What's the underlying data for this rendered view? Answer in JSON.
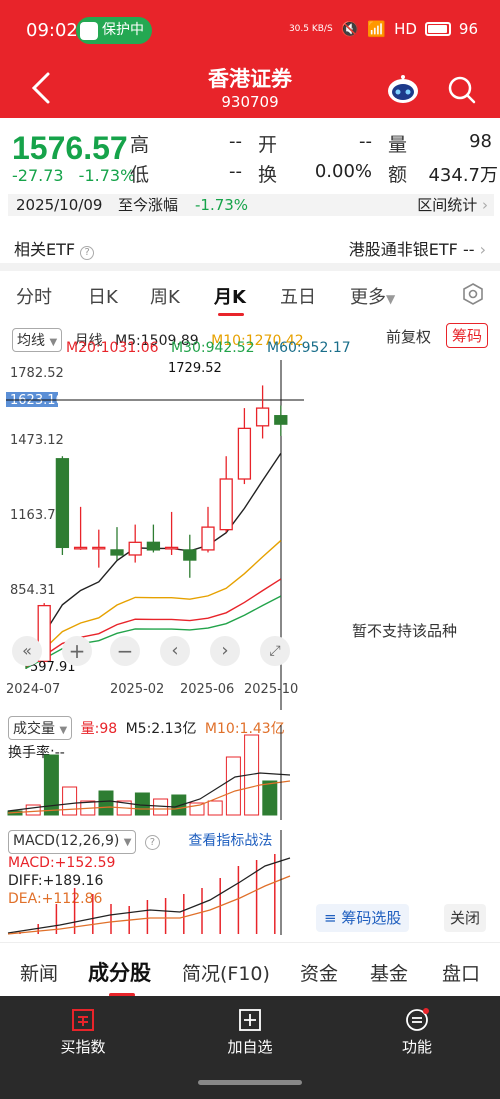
{
  "status_bar": {
    "time": "09:02",
    "protect_label": "保护中",
    "net_speed": "30.5 KB/S",
    "hd": "HD",
    "battery": "96"
  },
  "header": {
    "title": "香港证券",
    "code": "930709"
  },
  "quote": {
    "price": "1576.57",
    "change": "-27.73",
    "change_pct": "-1.73%",
    "high_label": "高",
    "high_value": "--",
    "open_label": "开",
    "open_value": "--",
    "volume_label": "量",
    "volume_value": "98",
    "low_label": "低",
    "low_value": "--",
    "turnover_label": "换",
    "turnover_value": "0.00%",
    "amount_label": "额",
    "amount_value": "434.7万",
    "date": "2025/10/09",
    "to_date_label": "至今涨幅",
    "to_date_value": "-1.73%",
    "interval_stats": "区间统计"
  },
  "etf": {
    "label": "相关ETF",
    "link": "港股通非银ETF",
    "value": "--"
  },
  "period_tabs": [
    "分时",
    "日K",
    "周K",
    "月K",
    "五日",
    "更多"
  ],
  "active_period": "月K",
  "ma": {
    "selector": "均线",
    "period": "月线",
    "m5": "M5:1509.89",
    "m10": "M10:1270.42",
    "m20": "M20:1031.06",
    "m30": "M30:942.52",
    "m60": "M60:952.17",
    "fq": "前复权",
    "chip": "筹码"
  },
  "price_axis": [
    "1782.52",
    "1623.16",
    "1473.12",
    "1163.72",
    "854.31"
  ],
  "annotations": {
    "high": "1729.52",
    "low": "597.91"
  },
  "x_axis": [
    "2024-07",
    "2025-02",
    "2025-06",
    "2025-10"
  ],
  "volume": {
    "selector": "成交量",
    "vol": "量:98",
    "m5": "M5:2.13亿",
    "m10": "M10:1.43亿",
    "turnover": "换手率:--"
  },
  "macd": {
    "selector": "MACD(12,26,9)",
    "link": "查看指标战法",
    "macd": "MACD:+152.59",
    "diff": "DIFF:+189.16",
    "dea": "DEA:+112.86"
  },
  "side_panel": {
    "message": "暂不支持该品种",
    "choose": "筹码选股",
    "close": "关闭"
  },
  "bottom_tabs": [
    "新闻",
    "成分股",
    "简况(F10)",
    "资金",
    "基金",
    "盘口"
  ],
  "active_bottom_tab": "成分股",
  "toolbar": {
    "buy": "买指数",
    "add": "加自选",
    "func": "功能"
  },
  "colors": {
    "red": "#e8242a",
    "green": "#16a34a",
    "up": "#e8242a",
    "down": "#2e7d32"
  },
  "chart_data": {
    "type": "candlestick",
    "title": "",
    "x_ticks": [
      "2024-07",
      "2025-02",
      "2025-06",
      "2025-10"
    ],
    "y_ticks": [
      "1782.52",
      "1623.16",
      "1473.12",
      "1163.72",
      "854.31"
    ],
    "ylim": [
      597.91,
      1782.52
    ],
    "candles": [
      {
        "o": 650,
        "c": 640,
        "h": 660,
        "l": 610
      },
      {
        "o": 640,
        "c": 860,
        "h": 870,
        "l": 630
      },
      {
        "o": 1440,
        "c": 1090,
        "h": 1450,
        "l": 1060
      },
      {
        "o": 1090,
        "c": 1090,
        "h": 1250,
        "l": 1080
      },
      {
        "o": 1090,
        "c": 1090,
        "h": 1160,
        "l": 1010
      },
      {
        "o": 1080,
        "c": 1060,
        "h": 1170,
        "l": 1040
      },
      {
        "o": 1060,
        "c": 1110,
        "h": 1180,
        "l": 1030
      },
      {
        "o": 1110,
        "c": 1080,
        "h": 1180,
        "l": 1070
      },
      {
        "o": 1090,
        "c": 1090,
        "h": 1230,
        "l": 1060
      },
      {
        "o": 1080,
        "c": 1040,
        "h": 1140,
        "l": 970
      },
      {
        "o": 1080,
        "c": 1170,
        "h": 1250,
        "l": 1070
      },
      {
        "o": 1160,
        "c": 1360,
        "h": 1450,
        "l": 1150
      },
      {
        "o": 1360,
        "c": 1560,
        "h": 1640,
        "l": 1340
      },
      {
        "o": 1570,
        "c": 1640,
        "h": 1729.52,
        "l": 1520
      },
      {
        "o": 1610,
        "c": 1576.57,
        "h": 1650,
        "l": 1530
      }
    ]
  }
}
